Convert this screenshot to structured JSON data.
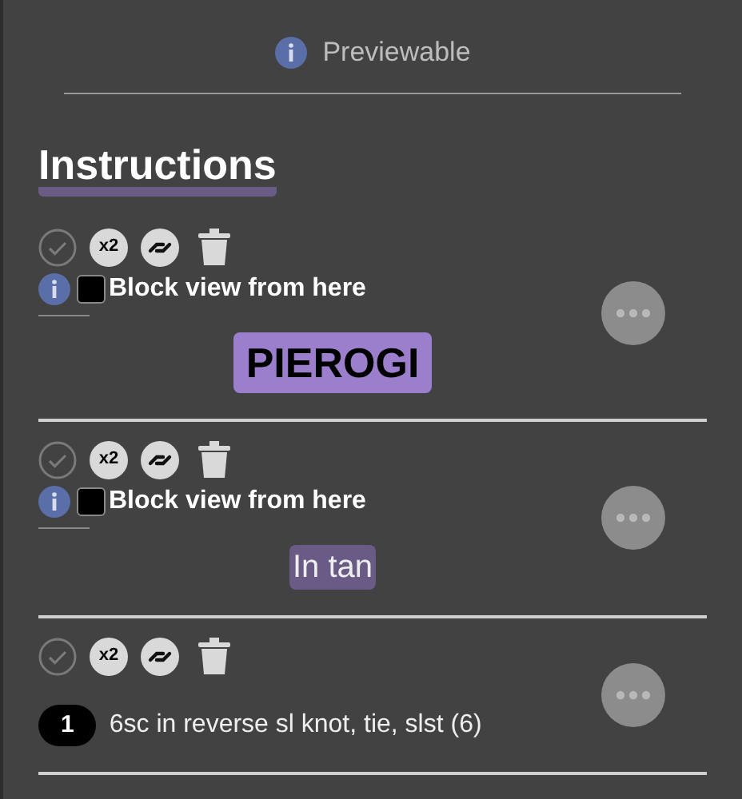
{
  "header": {
    "label": "Previewable"
  },
  "section": {
    "title": "Instructions"
  },
  "items": [
    {
      "kind": "block",
      "repeat_badge": "x2",
      "checked": false,
      "text": "Block view from here",
      "label": {
        "text": "PIEROGI",
        "kind": "strong"
      }
    },
    {
      "kind": "block",
      "repeat_badge": "x2",
      "checked": false,
      "text": "Block view from here",
      "label": {
        "text": "In tan",
        "kind": "subtle"
      }
    },
    {
      "kind": "step",
      "repeat_badge": "x2",
      "number": "1",
      "text": "6sc in reverse sl knot, tie, slst (6)"
    }
  ]
}
